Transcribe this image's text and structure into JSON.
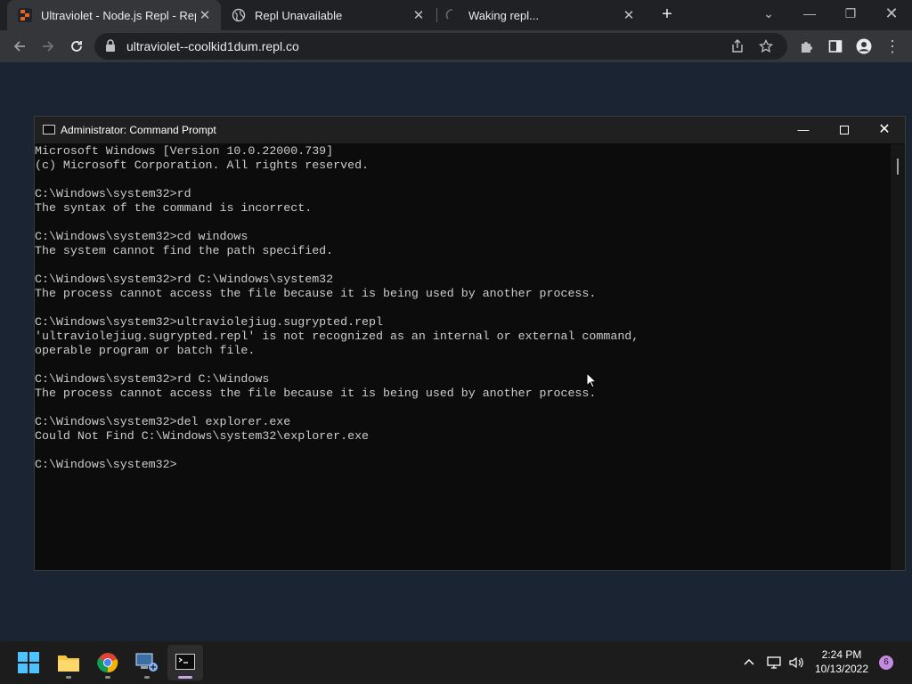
{
  "browser": {
    "tabs": [
      {
        "title": "Ultraviolet - Node.js Repl - Replit"
      },
      {
        "title": "Repl Unavailable"
      },
      {
        "title": "Waking repl..."
      }
    ],
    "url": "ultraviolet--coolkid1dum.repl.co"
  },
  "cmd": {
    "title": "Administrator: Command Prompt",
    "lines": [
      "Microsoft Windows [Version 10.0.22000.739]",
      "(c) Microsoft Corporation. All rights reserved.",
      "",
      "C:\\Windows\\system32>rd",
      "The syntax of the command is incorrect.",
      "",
      "C:\\Windows\\system32>cd windows",
      "The system cannot find the path specified.",
      "",
      "C:\\Windows\\system32>rd C:\\Windows\\system32",
      "The process cannot access the file because it is being used by another process.",
      "",
      "C:\\Windows\\system32>ultraviolejiug.sugrypted.repl",
      "'ultraviolejiug.sugrypted.repl' is not recognized as an internal or external command,",
      "operable program or batch file.",
      "",
      "C:\\Windows\\system32>rd C:\\Windows",
      "The process cannot access the file because it is being used by another process.",
      "",
      "C:\\Windows\\system32>del explorer.exe",
      "Could Not Find C:\\Windows\\system32\\explorer.exe",
      "",
      "C:\\Windows\\system32>"
    ]
  },
  "taskbar": {
    "time": "2:24 PM",
    "date": "10/13/2022",
    "notification_count": "6"
  }
}
